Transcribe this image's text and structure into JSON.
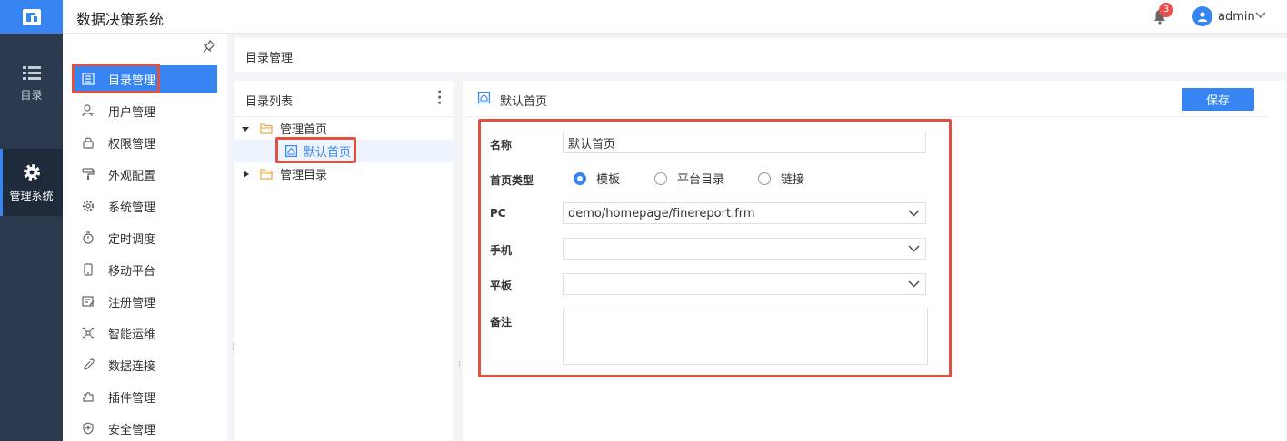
{
  "app": {
    "title": "数据决策系统"
  },
  "header": {
    "notification_count": "3",
    "user_name": "admin"
  },
  "rail": {
    "items": [
      {
        "label": "目录",
        "icon": "list-icon"
      },
      {
        "label": "管理系统",
        "icon": "gear-icon",
        "active": true
      }
    ]
  },
  "menu": {
    "items": [
      {
        "label": "目录管理",
        "icon": "directory-icon",
        "active": true
      },
      {
        "label": "用户管理",
        "icon": "user-icon"
      },
      {
        "label": "权限管理",
        "icon": "lock-icon"
      },
      {
        "label": "外观配置",
        "icon": "paint-roller-icon"
      },
      {
        "label": "系统管理",
        "icon": "settings-icon"
      },
      {
        "label": "定时调度",
        "icon": "timer-icon"
      },
      {
        "label": "移动平台",
        "icon": "mobile-icon"
      },
      {
        "label": "注册管理",
        "icon": "register-icon"
      },
      {
        "label": "智能运维",
        "icon": "network-icon"
      },
      {
        "label": "数据连接",
        "icon": "link-icon"
      },
      {
        "label": "插件管理",
        "icon": "plugin-icon"
      },
      {
        "label": "安全管理",
        "icon": "shield-icon"
      }
    ]
  },
  "breadcrumb": {
    "text": "目录管理"
  },
  "directory": {
    "title": "目录列表",
    "tree": [
      {
        "label": "管理首页",
        "expanded": true
      },
      {
        "label": "默认首页",
        "selected": true
      },
      {
        "label": "管理目录",
        "expanded": false
      }
    ]
  },
  "editor": {
    "title": "默认首页",
    "save_label": "保存",
    "fields": {
      "name_label": "名称",
      "name_value": "默认首页",
      "type_label": "首页类型",
      "type_options": [
        "模板",
        "平台目录",
        "链接"
      ],
      "type_selected": "模板",
      "pc_label": "PC",
      "pc_value": "demo/homepage/finereport.frm",
      "phone_label": "手机",
      "phone_value": "",
      "tablet_label": "平板",
      "tablet_value": "",
      "note_label": "备注",
      "note_value": ""
    }
  },
  "colors": {
    "accent": "#3685f2",
    "rail_bg": "#2b3a4f",
    "highlight": "#e0513f"
  }
}
